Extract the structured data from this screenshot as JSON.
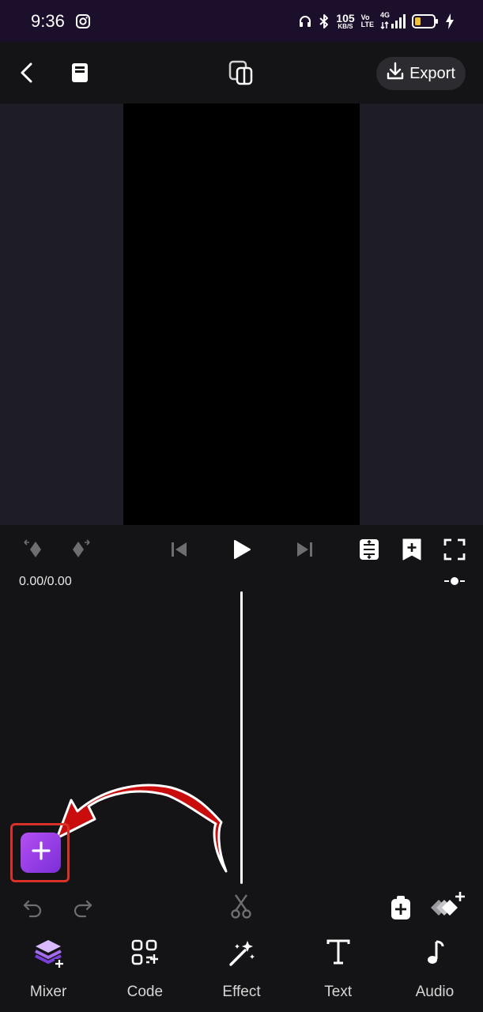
{
  "status_bar": {
    "time": "9:36",
    "net_speed_value": "105",
    "net_speed_unit": "KB/S",
    "volte_top": "Vo",
    "volte_bottom": "LTE",
    "network_type": "4G",
    "icons": [
      "instagram-icon",
      "headphones-icon",
      "bluetooth-icon",
      "signal-icon",
      "battery-icon",
      "charging-icon"
    ]
  },
  "top_bar": {
    "export_label": "Export",
    "icons": [
      "back-icon",
      "project-icon",
      "aspect-ratio-icon",
      "download-icon"
    ]
  },
  "playback": {
    "time_display": "0.00/0.00",
    "icons": [
      "keyframe-prev-icon",
      "keyframe-next-icon",
      "skip-back-icon",
      "play-icon",
      "skip-forward-icon",
      "align-icon",
      "bookmark-add-icon",
      "fullscreen-icon",
      "zoom-icon"
    ]
  },
  "timeline": {
    "icons": [
      "add-media-icon",
      "undo-icon",
      "redo-icon",
      "scissors-icon",
      "clip-add-icon",
      "layers-add-icon"
    ]
  },
  "bottom_nav": {
    "items": [
      {
        "label": "Mixer",
        "icon": "mixer-icon"
      },
      {
        "label": "Code",
        "icon": "code-icon"
      },
      {
        "label": "Effect",
        "icon": "effect-icon"
      },
      {
        "label": "Text",
        "icon": "text-icon"
      },
      {
        "label": "Audio",
        "icon": "audio-icon"
      }
    ]
  },
  "colors": {
    "status_bar_bg": "#1c0f2b",
    "app_bg": "#141416",
    "preview_bg": "#1e1d26",
    "accent_purple": "#a544ec",
    "annotation_red": "#d93028"
  }
}
